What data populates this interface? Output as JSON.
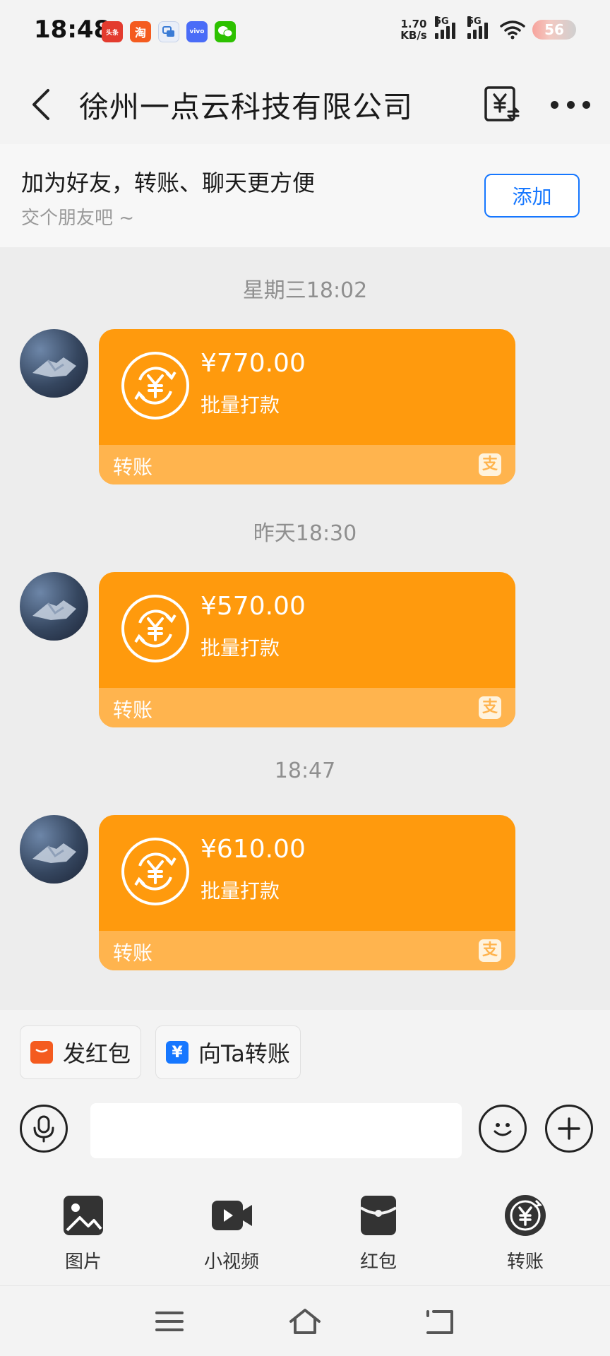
{
  "status_bar": {
    "time": "18:48",
    "app_icons": [
      {
        "name": "toutiao-icon",
        "text": "头条",
        "color": "#e33b2e"
      },
      {
        "name": "taobao-icon",
        "text": "淘",
        "color": "#f45b1f"
      },
      {
        "name": "notes-icon",
        "text": "",
        "color": "#3a7bd5"
      },
      {
        "name": "vivo-icon",
        "text": "vivo",
        "color": "#4a6cf7"
      },
      {
        "name": "wechat-icon",
        "text": "",
        "color": "#2dc100"
      }
    ],
    "net_speed_value": "1.70",
    "net_speed_unit": "KB/s",
    "signal_1_label": "5G",
    "signal_2_label": "5G",
    "battery": "56"
  },
  "header": {
    "title": "徐州一点云科技有限公司"
  },
  "banner": {
    "title": "加为好友，转账、聊天更方便",
    "subtitle": "交个朋友吧 ~",
    "add_button": "添加"
  },
  "messages": [
    {
      "timestamp": "星期三18:02",
      "amount": "¥770.00",
      "description": "批量打款",
      "type_label": "转账"
    },
    {
      "timestamp": "昨天18:30",
      "amount": "¥570.00",
      "description": "批量打款",
      "type_label": "转账"
    },
    {
      "timestamp": "18:47",
      "amount": "¥610.00",
      "description": "批量打款",
      "type_label": "转账"
    }
  ],
  "alipay_logo_char": "支",
  "quick_actions": {
    "red_packet": "发红包",
    "transfer": "向Ta转账"
  },
  "input": {
    "placeholder": ""
  },
  "tools": {
    "image": "图片",
    "video": "小视频",
    "red_packet": "红包",
    "transfer": "转账"
  },
  "colors": {
    "card_orange": "#ff9a0d",
    "card_footer": "#ffb44e",
    "accent_blue": "#1677ff",
    "red_packet": "#f45b1f"
  }
}
